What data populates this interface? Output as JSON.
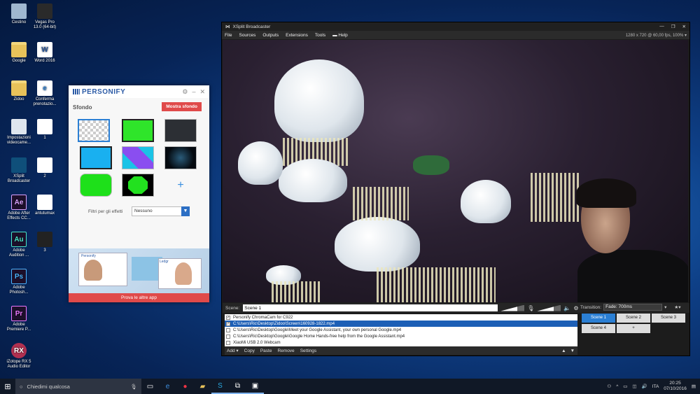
{
  "desktop": {
    "icons": [
      {
        "label": "Cestino",
        "icon": "recycle-bin"
      },
      {
        "label": "Vegas Pro 13.0 (64-bit)",
        "icon": "film"
      },
      {
        "label": "Google",
        "icon": "folder"
      },
      {
        "label": "Word 2016",
        "icon": "word",
        "glyph": "W"
      },
      {
        "label": "Zidoo",
        "icon": "folder"
      },
      {
        "label": "Conferma prenotazio...",
        "icon": "pdf",
        "glyph": "e"
      },
      {
        "label": "Impostazioni videocame...",
        "icon": "webcam"
      },
      {
        "label": "1",
        "icon": "document"
      },
      {
        "label": "XSplit Broadcaster",
        "icon": "xsplit"
      },
      {
        "label": "2",
        "icon": "document"
      },
      {
        "label": "Adobe After Effects CC...",
        "icon": "after-effects",
        "glyph": "Ae"
      },
      {
        "label": "antutumax",
        "icon": "document"
      },
      {
        "label": "Adobe Audition ...",
        "icon": "audition",
        "glyph": "Au"
      },
      {
        "label": "3",
        "icon": "screenshot"
      },
      {
        "label": "Adobe Photosh...",
        "icon": "photoshop",
        "glyph": "Ps"
      },
      {
        "label": "Adobe Premiere P...",
        "icon": "premiere",
        "glyph": "Pr"
      },
      {
        "label": "iZotope RX 5 Audio Editor",
        "icon": "izotope",
        "glyph": "RX"
      }
    ]
  },
  "personify": {
    "brand": "PERSONIFY",
    "section": "Sfondo",
    "show_button": "Mostra sfondo",
    "add_symbol": "+",
    "filter_label": "Filtri per gli effetti",
    "filter_value": "Nessuno",
    "cta": "Prova le altre app",
    "banner_brand": "Personify",
    "banner_app": "Ledgr"
  },
  "xsplit": {
    "title": "XSplit Broadcaster",
    "menu": [
      "File",
      "Sources",
      "Outputs",
      "Extensions",
      "Tools",
      "Help"
    ],
    "resolution": "1280 x 720 @ 60,00 fps, 100%",
    "scene_label": "Scene:",
    "scene_name": "Scene 1",
    "sources": [
      {
        "checked": true,
        "name": "Personify ChromaCam for C922",
        "selected": false
      },
      {
        "checked": true,
        "name": "C:\\Users\\Ric\\Desktop\\Zidoo\\Screen\\160928-1822.mp4",
        "selected": true
      },
      {
        "checked": false,
        "name": "C:\\Users\\Ric\\Desktop\\Google\\Meet your Google Assistant, your own personal Google.mp4",
        "selected": false
      },
      {
        "checked": false,
        "name": "C:\\Users\\Ric\\Desktop\\Google\\Google Home  Hands-free help from the Google Assistant.mp4",
        "selected": false
      },
      {
        "checked": false,
        "name": "XiaoMi USB 2.0 Webcam",
        "selected": false
      }
    ],
    "source_actions": {
      "add": "Add",
      "copy": "Copy",
      "paste": "Paste",
      "remove": "Remove",
      "settings": "Settings"
    },
    "transition_label": "Transition:",
    "transition_value": "Fade: 700ms",
    "scenes": [
      "Scene 1",
      "Scene 2",
      "Scene 3",
      "Scene 4",
      "+"
    ],
    "active_scene": "Scene 1"
  },
  "taskbar": {
    "search_placeholder": "Chiedimi qualcosa",
    "lang": "ITA",
    "time": "20:25",
    "date": "07/10/2016"
  }
}
